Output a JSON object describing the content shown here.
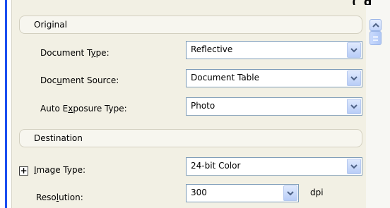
{
  "top_clip_text": "( g",
  "sections": {
    "original": {
      "title": "Original",
      "document_type": {
        "label_pre": "Document T",
        "label_ul": "y",
        "label_post": "pe:",
        "value": "Reflective"
      },
      "document_source": {
        "label_pre": "Doc",
        "label_ul": "u",
        "label_post": "ment Source:",
        "value": "Document Table"
      },
      "auto_exposure": {
        "label_pre": "Auto E",
        "label_ul": "x",
        "label_post": "posure Type:",
        "value": "Photo"
      }
    },
    "destination": {
      "title": "Destination",
      "image_type": {
        "expand": "+",
        "label_pre": "",
        "label_ul": "I",
        "label_post": "mage Type:",
        "value": "24-bit Color"
      },
      "resolution": {
        "label_pre": "Reso",
        "label_ul": "l",
        "label_post": "ution:",
        "value": "300",
        "unit": "dpi"
      }
    }
  },
  "icons": {
    "dropdown": "chevron-down-icon",
    "scroll_up": "chevron-up-icon",
    "expand": "plus-icon"
  },
  "colors": {
    "accent_blue": "#1c4ff0",
    "panel_bg": "#f2f0e4",
    "field_border": "#7f9db9"
  }
}
